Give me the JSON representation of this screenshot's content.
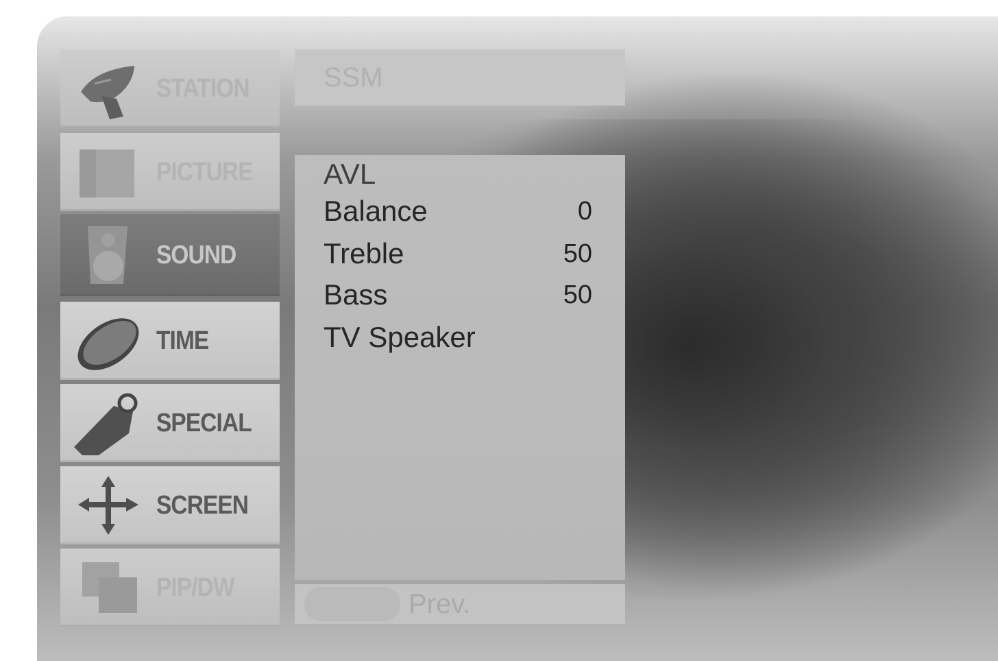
{
  "main_menu": {
    "items": [
      {
        "label": "STATION",
        "icon": "satellite-dish-icon",
        "state": "faded"
      },
      {
        "label": "PICTURE",
        "icon": "picture-frame-icon",
        "state": "faded"
      },
      {
        "label": "SOUND",
        "icon": "speaker-icon",
        "state": "selected"
      },
      {
        "label": "TIME",
        "icon": "clock-icon",
        "state": "normal"
      },
      {
        "label": "SPECIAL",
        "icon": "tag-icon",
        "state": "normal"
      },
      {
        "label": "SCREEN",
        "icon": "move-arrows-icon",
        "state": "normal"
      },
      {
        "label": "PIP/DW",
        "icon": "pip-windows-icon",
        "state": "faded"
      }
    ]
  },
  "sound_menu": {
    "header": "SSM",
    "items": [
      {
        "label": "AVL",
        "value": ""
      },
      {
        "label": "Balance",
        "value": "0"
      },
      {
        "label": "Treble",
        "value": "50"
      },
      {
        "label": "Bass",
        "value": "50"
      },
      {
        "label": "TV Speaker",
        "value": ""
      }
    ]
  },
  "footer": {
    "prev_label": "Prev."
  }
}
